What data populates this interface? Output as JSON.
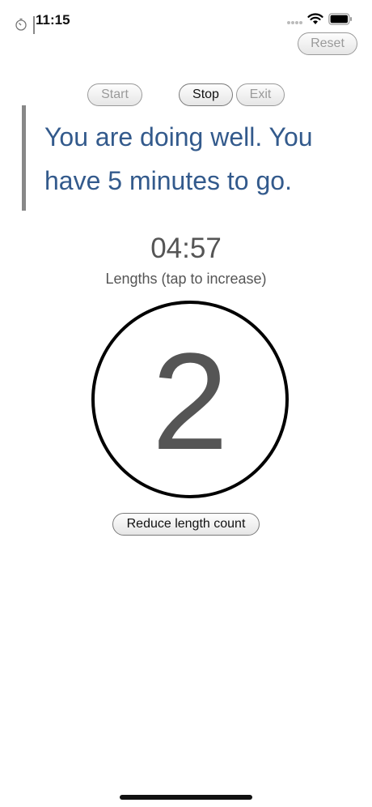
{
  "status_bar": {
    "time": "11:15",
    "icons": [
      "timer-icon",
      "signal-icon",
      "wifi-icon",
      "battery-icon"
    ]
  },
  "toolbar": {
    "reset_label": "Reset",
    "start_label": "Start",
    "stop_label": "Stop",
    "exit_label": "Exit"
  },
  "message": "You are doing well. You have 5 minutes to go.",
  "timer": {
    "countdown": "04:57"
  },
  "lengths": {
    "label": "Lengths (tap to increase)",
    "count": "2",
    "reduce_label": "Reduce length count"
  },
  "colors": {
    "message_text": "#335a8c",
    "muted_text": "#555555",
    "disabled_text": "#9a9a9a"
  }
}
